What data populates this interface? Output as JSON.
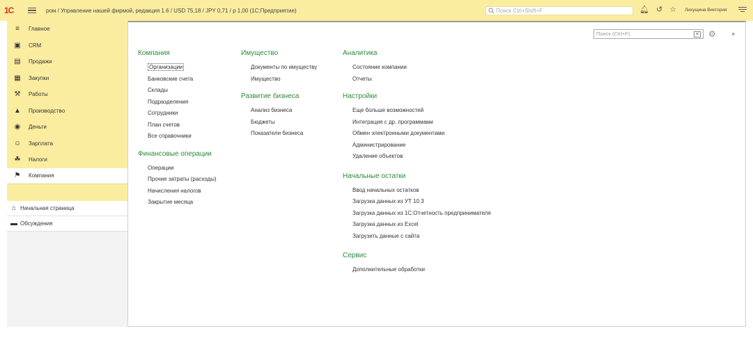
{
  "topbar": {
    "logo": "1С",
    "title": "ром / Управление нашей фирмой, редакция 1.6 / USD 75,18 / JPY 0,71 / р 1,00  (1С:Предприятие)",
    "search_placeholder": "Поиск Ctrl+Shift+F",
    "user": "Лихущина Виктория"
  },
  "sidebar": {
    "items": [
      {
        "label": "Главное",
        "icon": "menu-icon"
      },
      {
        "label": "CRM",
        "icon": "crm-icon"
      },
      {
        "label": "Продажи",
        "icon": "cart-icon"
      },
      {
        "label": "Закупки",
        "icon": "purchases-icon"
      },
      {
        "label": "Работы",
        "icon": "works-icon"
      },
      {
        "label": "Производство",
        "icon": "factory-icon"
      },
      {
        "label": "Деньги",
        "icon": "money-icon"
      },
      {
        "label": "Зарплата",
        "icon": "salary-icon"
      },
      {
        "label": "Налоги",
        "icon": "taxes-icon"
      },
      {
        "label": "Компания",
        "icon": "flag-icon"
      }
    ],
    "pages": [
      {
        "label": "Начальная страница",
        "icon": "home-icon"
      },
      {
        "label": "Обсуждения",
        "icon": "discussion-icon"
      }
    ]
  },
  "main": {
    "search_placeholder": "Поиск (Ctrl+F)",
    "search_clear": "×",
    "close": "×",
    "sections": {
      "company": {
        "title": "Компания",
        "links": [
          "Организации",
          "Банковские счета",
          "Склады",
          "Подразделения",
          "Сотрудники",
          "План счетов",
          "Все справочники"
        ]
      },
      "finance": {
        "title": "Финансовые операции",
        "links": [
          "Операции",
          "Прочие затраты (расходы)",
          "Начисления налогов",
          "Закрытие месяца"
        ]
      },
      "property": {
        "title": "Имущество",
        "links": [
          "Документы по имуществу",
          "Имущество"
        ]
      },
      "business": {
        "title": "Развитие бизнеса",
        "links": [
          "Анализ бизнеса",
          "Бюджеты",
          "Показатели бизнеса"
        ]
      },
      "analytics": {
        "title": "Аналитика",
        "links": [
          "Состояние компании",
          "Отчеты"
        ]
      },
      "settings": {
        "title": "Настройки",
        "links": [
          "Еще больше возможностей",
          "Интеграция с др. программами",
          "Обмен электронными документами",
          "Администрирование",
          "Удаление объектов"
        ]
      },
      "initial": {
        "title": "Начальные остатки",
        "links": [
          "Ввод начальных остатков",
          "Загрузка данных из УТ 10.3",
          "Загрузка данных из 1С:Отчетность предпринимателя",
          "Загрузка данных из Excel",
          "Загрузить данные с сайта"
        ]
      },
      "service": {
        "title": "Сервис",
        "links": [
          "Дополнительные обработки"
        ]
      }
    }
  }
}
